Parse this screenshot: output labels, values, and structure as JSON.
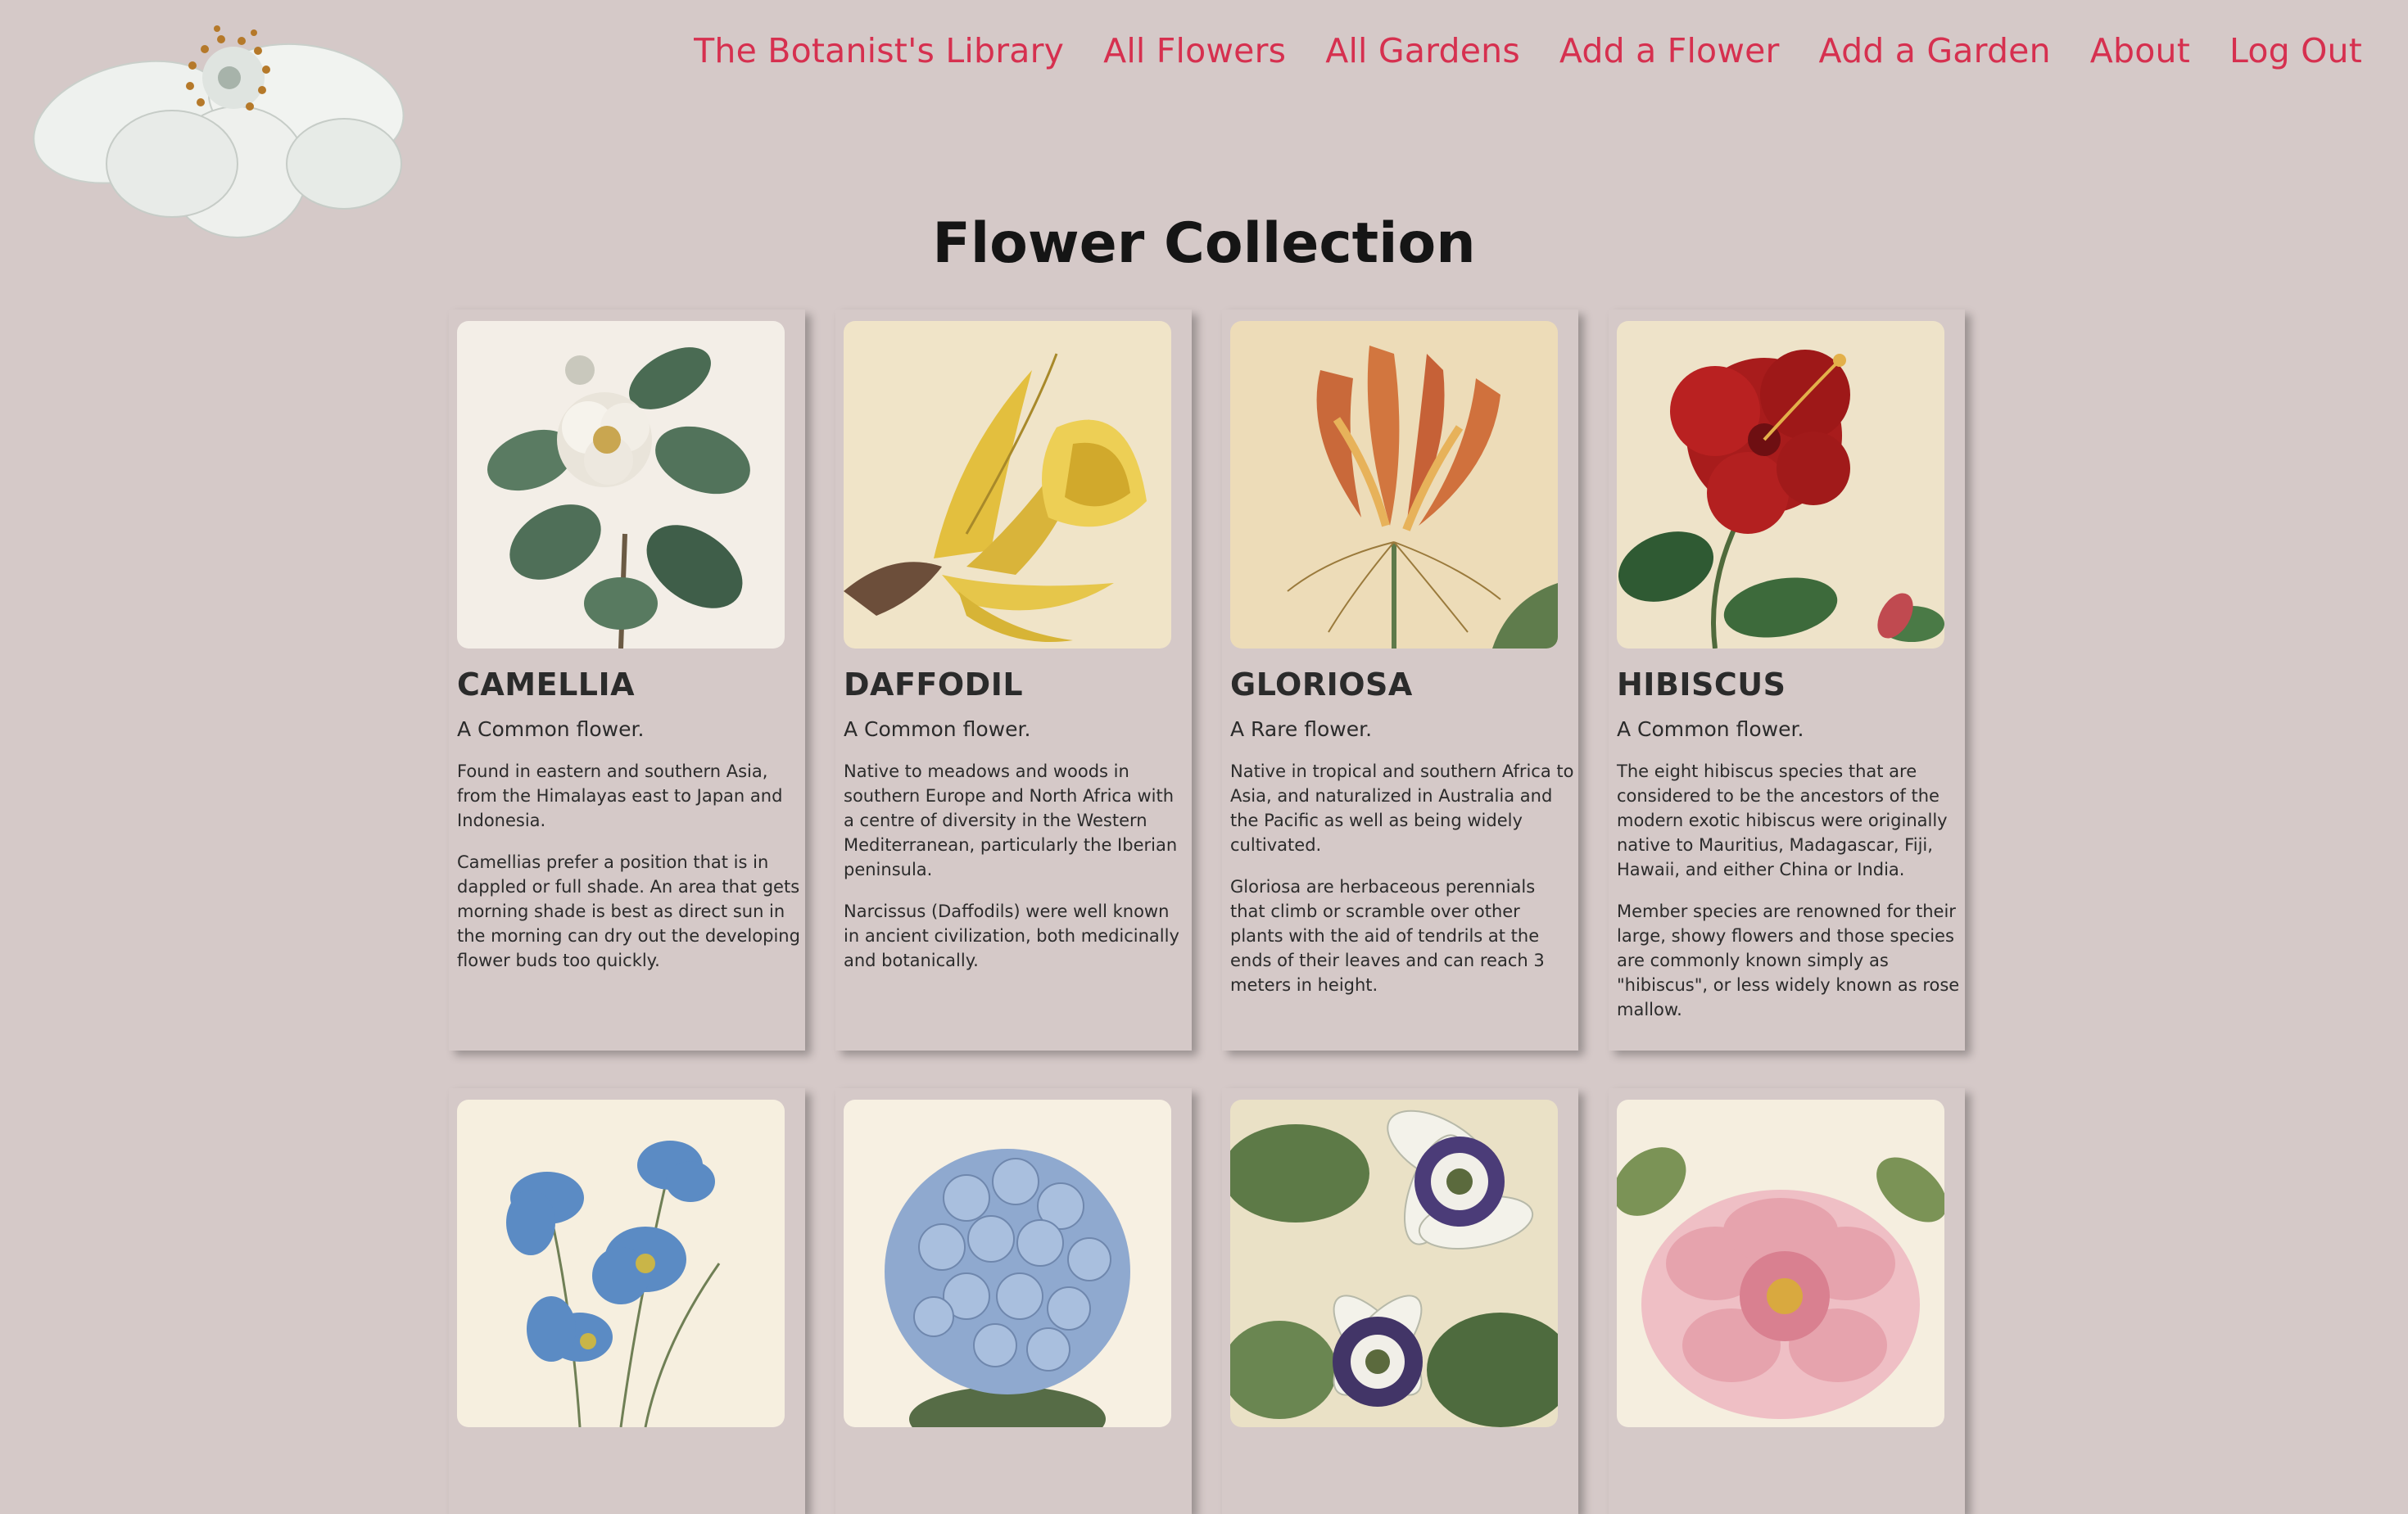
{
  "nav": {
    "items": [
      {
        "label": "The Botanist's Library"
      },
      {
        "label": "All Flowers"
      },
      {
        "label": "All Gardens"
      },
      {
        "label": "Add a Flower"
      },
      {
        "label": "Add a Garden"
      },
      {
        "label": "About"
      },
      {
        "label": "Log Out"
      }
    ],
    "color": "#d6304f"
  },
  "page": {
    "title": "Flower Collection",
    "background": "#d5c9c8"
  },
  "flowers": [
    {
      "name": "CAMELLIA",
      "rarity": "A Common flower.",
      "origin": "Found in eastern and southern Asia, from the Himalayas east to Japan and Indonesia.",
      "description": "Camellias prefer a position that is in dappled or full shade. An area that gets morning shade is best as direct sun in the morning can dry out the developing flower buds too quickly."
    },
    {
      "name": "DAFFODIL",
      "rarity": "A Common flower.",
      "origin": "Native to meadows and woods in southern Europe and North Africa with a centre of diversity in the Western Mediterranean, particularly the Iberian peninsula.",
      "description": "Narcissus (Daffodils) were well known in ancient civilization, both medicinally and botanically."
    },
    {
      "name": "GLORIOSA",
      "rarity": "A Rare flower.",
      "origin": "Native in tropical and southern Africa to Asia, and naturalized in Australia and the Pacific as well as being widely cultivated.",
      "description": "Gloriosa are herbaceous perennials that climb or scramble over other plants with the aid of tendrils at the ends of their leaves and can reach 3 meters in height."
    },
    {
      "name": "HIBISCUS",
      "rarity": "A Common flower.",
      "origin": "The eight hibiscus species that are considered to be the ancestors of the modern exotic hibiscus were originally native to Mauritius, Madagascar, Fiji, Hawaii, and either China or India.",
      "description": "Member species are renowned for their large, showy flowers and those species are commonly known simply as \"hibiscus\", or less widely known as rose mallow."
    }
  ]
}
